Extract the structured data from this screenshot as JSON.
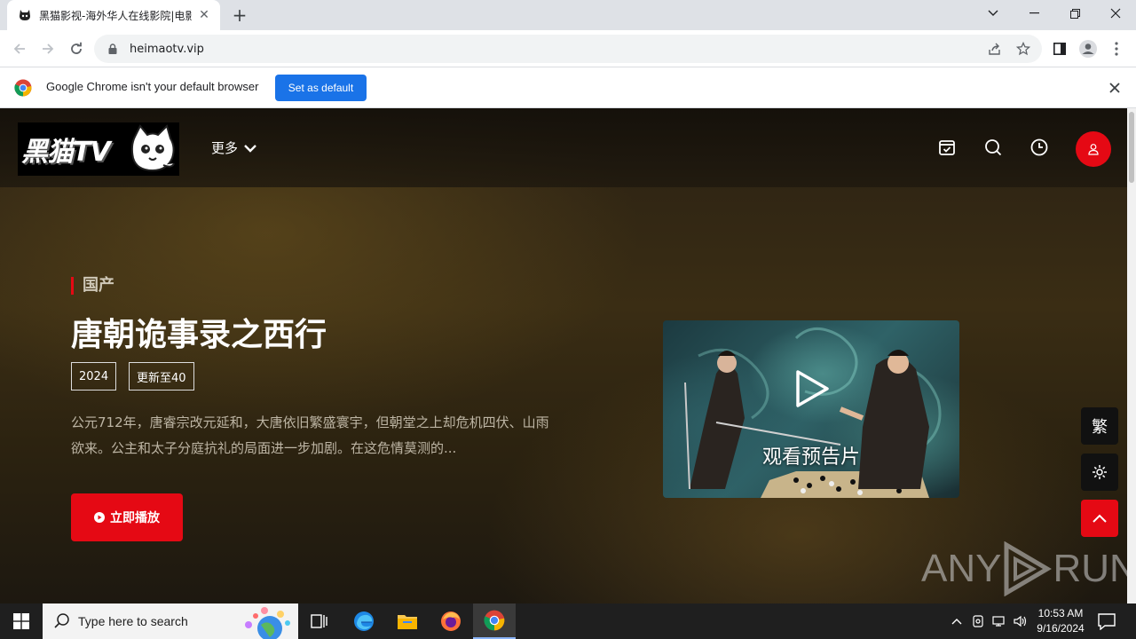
{
  "browser": {
    "tab_title": "黑猫影视-海外华人在线影院|电影",
    "url": "heimaotv.vip",
    "infobar_message": "Google Chrome isn't your default browser",
    "infobar_button": "Set as default"
  },
  "site": {
    "logo_text": "黑猫TV",
    "nav_more": "更多"
  },
  "hero": {
    "category": "国产",
    "title": "唐朝诡事录之西行",
    "tags": [
      "2024",
      "更新至40"
    ],
    "description": "公元712年，唐睿宗改元延和，大唐依旧繁盛寰宇，但朝堂之上却危机四伏、山雨欲来。公主和太子分庭抗礼的局面进一步加剧。在这危情莫测的...",
    "play_button": "立即播放",
    "trailer_label": "观看预告片"
  },
  "side_tools": {
    "traditional": "繁"
  },
  "watermark": {
    "left": "ANY",
    "right": "RUN"
  },
  "taskbar": {
    "search_placeholder": "Type here to search",
    "time": "10:53 AM",
    "date": "9/16/2024"
  },
  "colors": {
    "accent": "#e50914",
    "chrome_blue": "#1a73e8"
  }
}
